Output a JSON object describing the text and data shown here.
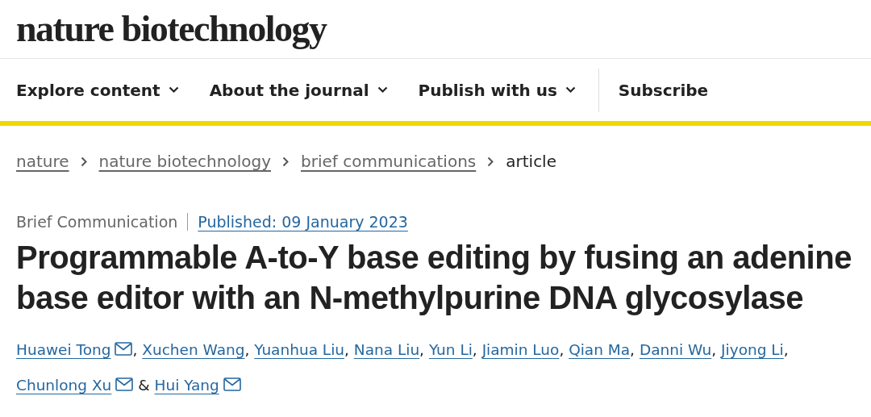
{
  "logo": "nature biotechnology",
  "nav": [
    {
      "label": "Explore content",
      "kind": "dropdown"
    },
    {
      "label": "About the journal",
      "kind": "dropdown"
    },
    {
      "label": "Publish with us",
      "kind": "dropdown"
    },
    {
      "label": "Subscribe",
      "kind": "link"
    }
  ],
  "breadcrumbs": [
    {
      "label": "nature",
      "current": false
    },
    {
      "label": "nature biotechnology",
      "current": false
    },
    {
      "label": "brief communications",
      "current": false
    },
    {
      "label": "article",
      "current": true
    }
  ],
  "article_type": "Brief Communication",
  "published": "Published: 09 January 2023",
  "title": "Programmable A-to-Y base editing by fusing an adenine base editor with an N-methylpurine DNA glycosylase",
  "authors": [
    {
      "name": "Huawei Tong",
      "email": true,
      "separator": ","
    },
    {
      "name": "Xuchen Wang",
      "email": false,
      "separator": ","
    },
    {
      "name": "Yuanhua Liu",
      "email": false,
      "separator": ","
    },
    {
      "name": "Nana Liu",
      "email": false,
      "separator": ","
    },
    {
      "name": "Yun Li",
      "email": false,
      "separator": ","
    },
    {
      "name": "Jiamin Luo",
      "email": false,
      "separator": ","
    },
    {
      "name": "Qian Ma",
      "email": false,
      "separator": ","
    },
    {
      "name": "Danni Wu",
      "email": false,
      "separator": ","
    },
    {
      "name": "Jiyong Li",
      "email": false,
      "separator": ","
    },
    {
      "name": "Chunlong Xu",
      "email": true,
      "separator": " &"
    },
    {
      "name": "Hui Yang",
      "email": true
    }
  ]
}
